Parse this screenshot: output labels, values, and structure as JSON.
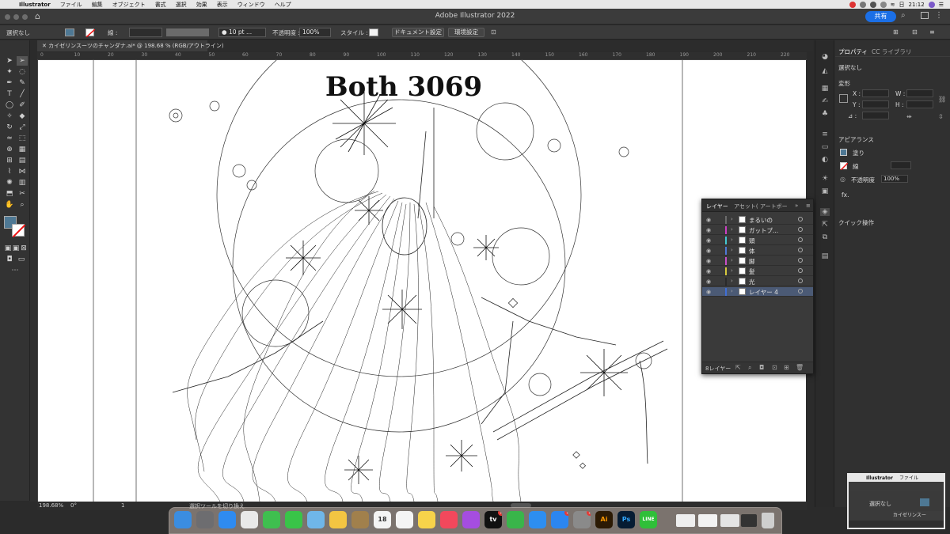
{
  "menubar": {
    "items": [
      "Illustrator",
      "ファイル",
      "編集",
      "オブジェクト",
      "書式",
      "選択",
      "効果",
      "表示",
      "ウィンドウ",
      "ヘルプ"
    ],
    "date": "日",
    "time": "21:12"
  },
  "titlebar": {
    "title": "Adobe Illustrator 2022",
    "share_label": "共有"
  },
  "controlbar": {
    "selection": "選択なし",
    "stroke_label": "線 :",
    "brush_size": "10 pt ...",
    "opacity_label": "不透明度 :",
    "opacity_value": "100%",
    "style_label": "スタイル :",
    "doc_settings_button": "ドキュメント設定",
    "prefs_button": "環境設定"
  },
  "document": {
    "tab_title": "カイゼリンスーツのチャンダナ.ai* @ 198.68 % (RGB/アウトライン)",
    "ruler_labels": [
      "0",
      "10",
      "20",
      "30",
      "40",
      "50",
      "60",
      "70",
      "80",
      "90",
      "100",
      "110",
      "120",
      "130",
      "140",
      "150",
      "160",
      "170",
      "180",
      "190",
      "200",
      "210",
      "220"
    ],
    "artwork_title": "Both 3069"
  },
  "statusbar": {
    "zoom": "198.68%",
    "rotation": "0°",
    "artboard": "1",
    "hint": "選択ツールを切り換え"
  },
  "properties": {
    "tab_props": "プロパティ",
    "tab_cc": "CC ライブラリ",
    "selection": "選択なし",
    "transform_heading": "変形",
    "x_label": "X :",
    "y_label": "Y :",
    "w_label": "W :",
    "h_label": "H :",
    "angle_label": "⊿ :",
    "appearance_heading": "アピアランス",
    "fill_label": "塗り",
    "stroke_label": "線",
    "opacity_label": "不透明度",
    "opacity_value": "100%",
    "fx_label": "fx.",
    "quick_actions": "クイック操作"
  },
  "layers": {
    "tabs": [
      "レイヤー",
      "アセット(",
      "アートボー"
    ],
    "rows": [
      {
        "name": "まるいの",
        "color": "#6b6b6b"
      },
      {
        "name": "ガットプ...",
        "color": "#cc3fc4"
      },
      {
        "name": "頭",
        "color": "#45c9d1"
      },
      {
        "name": "体",
        "color": "#4f7ad8"
      },
      {
        "name": "脚",
        "color": "#c94fc9"
      },
      {
        "name": "髪",
        "color": "#d6c93d"
      },
      {
        "name": "光",
        "color": "#2a2a2a"
      },
      {
        "name": "レイヤー 4",
        "color": "#3f6fd6"
      }
    ],
    "count_label": "8レイヤー"
  },
  "dock": {
    "apps": [
      {
        "name": "Finder",
        "color": "#3b8de0",
        "badge": ""
      },
      {
        "name": "Launchpad",
        "color": "#6d6d70",
        "badge": ""
      },
      {
        "name": "Safari",
        "color": "#2f8bf0",
        "badge": ""
      },
      {
        "name": "Chrome",
        "color": "#e9e9e9",
        "badge": ""
      },
      {
        "name": "FaceTime",
        "color": "#3fbf4f",
        "badge": ""
      },
      {
        "name": "Messages",
        "color": "#39c448",
        "badge": ""
      },
      {
        "name": "Maps",
        "color": "#6fb6e9",
        "badge": ""
      },
      {
        "name": "Photos",
        "color": "#f3c542",
        "badge": ""
      },
      {
        "name": "Notes-brown",
        "color": "#a1804c",
        "badge": ""
      },
      {
        "name": "Calendar",
        "color": "#f4f4f4",
        "badge": ""
      },
      {
        "name": "Reminders",
        "color": "#f4f4f4",
        "badge": ""
      },
      {
        "name": "Notes",
        "color": "#f7d34a",
        "badge": ""
      },
      {
        "name": "Music",
        "color": "#f2485c",
        "badge": ""
      },
      {
        "name": "Podcasts",
        "color": "#a54de0",
        "badge": ""
      },
      {
        "name": "TV",
        "color": "#111111",
        "badge": "1"
      },
      {
        "name": "Numbers",
        "color": "#39b54a",
        "badge": ""
      },
      {
        "name": "Keynote",
        "color": "#2d8ef0",
        "badge": ""
      },
      {
        "name": "App Store",
        "color": "#2c86f0",
        "badge": "1"
      },
      {
        "name": "System Preferences",
        "color": "#8a8a8a",
        "badge": "1"
      },
      {
        "name": "Illustrator",
        "color": "#2c1a04",
        "badge": ""
      },
      {
        "name": "Photoshop",
        "color": "#061c33",
        "badge": ""
      },
      {
        "name": "LINE",
        "color": "#2fbf39",
        "badge": ""
      }
    ],
    "calendar_day": "18",
    "ai_label": "Ai",
    "ps_label": "Ps",
    "line_label": "LINE",
    "tv_label": "tv"
  },
  "thumbnail": {
    "menu_app": "Illustrator",
    "menu_file": "ファイル",
    "selection": "選択なし",
    "tab": "カイゼリンスー"
  }
}
